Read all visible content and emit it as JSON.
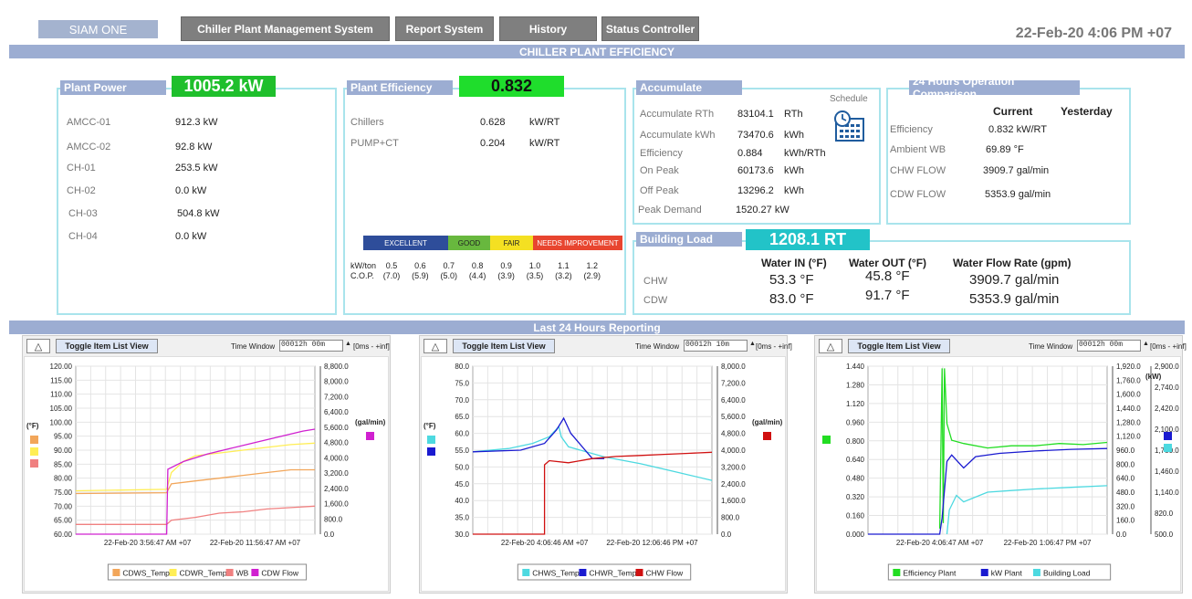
{
  "header": {
    "brand": "SIAM ONE",
    "nav": [
      "Chiller Plant Management System",
      "Report System",
      "History",
      "Status Controller"
    ],
    "datetime": "22-Feb-20 4:06 PM +07"
  },
  "banner_top": "CHILLER PLANT EFFICIENCY",
  "banner_mid": "Last 24 Hours Reporting",
  "plant_power": {
    "title": "Plant Power",
    "total": "1005.2 kW",
    "rows": [
      {
        "label": "AMCC-01",
        "value": "912.3 kW"
      },
      {
        "label": "AMCC-02",
        "value": "92.8 kW"
      },
      {
        "label": "CH-01",
        "value": "253.5 kW"
      },
      {
        "label": "CH-02",
        "value": "0.0 kW"
      },
      {
        "label": "CH-03",
        "value": "504.8 kW"
      },
      {
        "label": "CH-04",
        "value": "0.0 kW"
      }
    ]
  },
  "plant_efficiency": {
    "title": "Plant Efficiency",
    "total": "0.832",
    "rows": [
      {
        "label": "Chillers",
        "value": "0.628",
        "unit": "kW/RT"
      },
      {
        "label": "PUMP+CT",
        "value": "0.204",
        "unit": "kW/RT"
      }
    ],
    "scale_bands": [
      {
        "label": "EXCELLENT",
        "color": "#2e4d9a"
      },
      {
        "label": "GOOD",
        "color": "#68b83e"
      },
      {
        "label": "FAIR",
        "color": "#f4e022"
      },
      {
        "label": "NEEDS IMPROVEMENT",
        "color": "#e8452f"
      }
    ],
    "kwton_label": "kW/ton",
    "cop_label": "C.O.P.",
    "kwton": [
      "0.5",
      "0.6",
      "0.7",
      "0.8",
      "0.9",
      "1.0",
      "1.1",
      "1.2"
    ],
    "cop": [
      "(7.0)",
      "(5.9)",
      "(5.0)",
      "(4.4)",
      "(3.9)",
      "(3.5)",
      "(3.2)",
      "(2.9)"
    ]
  },
  "accumulate": {
    "title": "Accumulate",
    "schedule_label": "Schedule",
    "rows": [
      {
        "label": "Accumulate RTh",
        "value": "83104.1",
        "unit": "RTh"
      },
      {
        "label": "Accumulate kWh",
        "value": "73470.6",
        "unit": "kWh"
      },
      {
        "label": "Efficiency",
        "value": "0.884",
        "unit": "kWh/RTh"
      },
      {
        "label": "On Peak",
        "value": "60173.6",
        "unit": "kWh"
      },
      {
        "label": "Off Peak",
        "value": "13296.2",
        "unit": "kWh"
      },
      {
        "label": "Peak Demand",
        "value": "1520.27 kW",
        "unit": ""
      }
    ]
  },
  "comparison": {
    "title": "24 Hours Operation Comparison",
    "col_current": "Current",
    "col_yesterday": "Yesterday",
    "rows": [
      {
        "label": "Efficiency",
        "value": "0.832   kW/RT"
      },
      {
        "label": "Ambient  WB",
        "value": "69.89 °F"
      },
      {
        "label": "CHW FLOW",
        "value": "3909.7 gal/min"
      },
      {
        "label": "CDW FLOW",
        "value": "5353.9 gal/min"
      }
    ]
  },
  "building_load": {
    "title": "Building Load",
    "total": "1208.1  RT",
    "col_in": "Water IN (°F)",
    "col_out": "Water OUT (°F)",
    "col_flow": "Water Flow Rate (gpm)",
    "rows": [
      {
        "label": "CHW",
        "in": "53.3 °F",
        "out": "45.8 °F",
        "flow": "3909.7 gal/min"
      },
      {
        "label": "CDW",
        "in": "83.0 °F",
        "out": "91.7 °F",
        "flow": "5353.9 gal/min"
      }
    ]
  },
  "chart_controls": {
    "toggle_label": "Toggle Item List View",
    "tri_label": "△",
    "time_window_label": "Time Window",
    "range_label": "[0ms - +inf]"
  },
  "chart_data": [
    {
      "type": "line",
      "time_window": "00012h 00m",
      "x_ticks": [
        "22-Feb-20 3:56:47 AM +07",
        "22-Feb-20 11:56:47 AM +07"
      ],
      "left_unit": "(°F)",
      "right_unit": "(gal/min)",
      "ylim": [
        60,
        120
      ],
      "y2lim": [
        0,
        8800
      ],
      "y_ticks": [
        "120.00",
        "115.00",
        "110.00",
        "105.00",
        "100.00",
        "95.00",
        "90.00",
        "85.00",
        "80.00",
        "75.00",
        "70.00",
        "65.00",
        "60.00"
      ],
      "y2_ticks": [
        "8,800.0",
        "8,000.0",
        "7,200.0",
        "6,400.0",
        "5,600.0",
        "4,800.0",
        "4,000.0",
        "3,200.0",
        "2,400.0",
        "1,600.0",
        "800.0",
        "0.0"
      ],
      "series": [
        {
          "name": "CDWS_Temp",
          "color": "#f2a65a",
          "axis": "left",
          "points": [
            [
              0,
              74.5
            ],
            [
              0.38,
              74.8
            ],
            [
              0.4,
              78
            ],
            [
              0.5,
              79
            ],
            [
              0.6,
              80
            ],
            [
              0.7,
              81
            ],
            [
              0.8,
              82
            ],
            [
              0.9,
              83
            ],
            [
              1,
              83
            ]
          ]
        },
        {
          "name": "CDWR_Temp",
          "color": "#ffee55",
          "axis": "left",
          "points": [
            [
              0,
              75.5
            ],
            [
              0.38,
              76
            ],
            [
              0.4,
              82
            ],
            [
              0.45,
              86
            ],
            [
              0.5,
              88
            ],
            [
              0.6,
              89
            ],
            [
              0.7,
              90
            ],
            [
              0.8,
              91
            ],
            [
              0.9,
              92
            ],
            [
              1,
              92.5
            ]
          ]
        },
        {
          "name": "WB",
          "color": "#f08080",
          "axis": "left",
          "points": [
            [
              0,
              63.5
            ],
            [
              0.38,
              63.5
            ],
            [
              0.4,
              65
            ],
            [
              0.5,
              66
            ],
            [
              0.6,
              67.5
            ],
            [
              0.7,
              68
            ],
            [
              0.8,
              69
            ],
            [
              0.9,
              69.5
            ],
            [
              1,
              70
            ]
          ]
        },
        {
          "name": "CDW Flow",
          "color": "#d020d0",
          "axis": "right",
          "points": [
            [
              0,
              0
            ],
            [
              0.38,
              0
            ],
            [
              0.385,
              3400
            ],
            [
              0.45,
              3800
            ],
            [
              0.55,
              4200
            ],
            [
              0.65,
              4500
            ],
            [
              0.75,
              4800
            ],
            [
              0.85,
              5100
            ],
            [
              0.95,
              5400
            ],
            [
              1,
              5500
            ]
          ]
        }
      ]
    },
    {
      "type": "line",
      "time_window": "00012h 10m",
      "x_ticks": [
        "22-Feb-20 4:06:46 AM +07",
        "22-Feb-20 12:06:46 PM +07"
      ],
      "left_unit": "(°F)",
      "right_unit": "(gal/min)",
      "ylim": [
        30,
        80
      ],
      "y2lim": [
        0,
        8000
      ],
      "y_ticks": [
        "80.0",
        "75.0",
        "70.0",
        "65.0",
        "60.0",
        "55.0",
        "50.0",
        "45.0",
        "40.0",
        "35.0",
        "30.0"
      ],
      "y2_ticks": [
        "8,000.0",
        "7,200.0",
        "6,400.0",
        "5,600.0",
        "4,800.0",
        "4,000.0",
        "3,200.0",
        "2,400.0",
        "1,600.0",
        "800.0",
        "0.0"
      ],
      "series": [
        {
          "name": "CHWS_Temp",
          "color": "#4dd9e0",
          "axis": "left",
          "points": [
            [
              0,
              54.5
            ],
            [
              0.15,
              55.5
            ],
            [
              0.25,
              57
            ],
            [
              0.32,
              59
            ],
            [
              0.36,
              62
            ],
            [
              0.37,
              59
            ],
            [
              0.4,
              56
            ],
            [
              0.55,
              53
            ],
            [
              0.7,
              51
            ],
            [
              0.85,
              48.5
            ],
            [
              1,
              46
            ]
          ]
        },
        {
          "name": "CHWR_Temp",
          "color": "#1a1ad0",
          "axis": "left",
          "points": [
            [
              0,
              54.5
            ],
            [
              0.2,
              55
            ],
            [
              0.3,
              57
            ],
            [
              0.35,
              61
            ],
            [
              0.38,
              64.5
            ],
            [
              0.41,
              60
            ],
            [
              0.47,
              55
            ],
            [
              0.5,
              52.5
            ],
            [
              0.55,
              52.5
            ]
          ]
        },
        {
          "name": "CHW Flow",
          "color": "#d01010",
          "axis": "right",
          "points": [
            [
              0,
              0
            ],
            [
              0.3,
              0
            ],
            [
              0.3,
              3300
            ],
            [
              0.32,
              3500
            ],
            [
              0.4,
              3400
            ],
            [
              0.5,
              3600
            ],
            [
              0.6,
              3700
            ],
            [
              0.7,
              3750
            ],
            [
              0.8,
              3800
            ],
            [
              0.9,
              3850
            ],
            [
              1,
              3900
            ]
          ]
        }
      ]
    },
    {
      "type": "line",
      "time_window": "00012h 00m",
      "x_ticks": [
        "22-Feb-20 4:06:47 AM +07",
        "22-Feb-20 1:06:47 PM +07"
      ],
      "right_unit": "(kW)",
      "ylim": [
        0,
        1.52
      ],
      "y2lim": [
        0,
        2080
      ],
      "y_ticks": [
        "1.440",
        "1.280",
        "1.120",
        "0.960",
        "0.800",
        "0.640",
        "0.480",
        "0.320",
        "0.160",
        "0.000"
      ],
      "y2_ticks": [
        "1,920.0",
        "1,760.0",
        "1,600.0",
        "1,440.0",
        "1,280.0",
        "1,120.0",
        "960.0",
        "800.0",
        "640.0",
        "480.0",
        "320.0",
        "160.0",
        "0.0"
      ],
      "y3_ticks": [
        "2,900.0",
        "2,740.0",
        "2,420.0",
        "2,100.0",
        "1,780.0",
        "1,460.0",
        "1,140.0",
        "820.0",
        "500.0"
      ],
      "series": [
        {
          "name": "Efficiency Plant",
          "color": "#22dd22",
          "axis": "left",
          "points": [
            [
              0.3,
              0.05
            ],
            [
              0.31,
              1.5
            ],
            [
              0.315,
              0.1
            ],
            [
              0.32,
              1.5
            ],
            [
              0.33,
              1.0
            ],
            [
              0.35,
              0.85
            ],
            [
              0.4,
              0.82
            ],
            [
              0.5,
              0.78
            ],
            [
              0.6,
              0.8
            ],
            [
              0.7,
              0.8
            ],
            [
              0.8,
              0.82
            ],
            [
              0.9,
              0.81
            ],
            [
              1,
              0.83
            ]
          ]
        },
        {
          "name": "kW Plant",
          "color": "#1a1ad0",
          "axis": "right",
          "points": [
            [
              0,
              0
            ],
            [
              0.3,
              0
            ],
            [
              0.31,
              200
            ],
            [
              0.33,
              900
            ],
            [
              0.35,
              980
            ],
            [
              0.4,
              820
            ],
            [
              0.45,
              960
            ],
            [
              0.55,
              1000
            ],
            [
              0.7,
              1030
            ],
            [
              0.85,
              1050
            ],
            [
              1,
              1060
            ]
          ]
        },
        {
          "name": "Building Load",
          "color": "#4dd9e0",
          "axis": "right",
          "points": [
            [
              0.33,
              0
            ],
            [
              0.34,
              300
            ],
            [
              0.37,
              480
            ],
            [
              0.4,
              400
            ],
            [
              0.5,
              520
            ],
            [
              0.6,
              540
            ],
            [
              0.7,
              560
            ],
            [
              0.85,
              580
            ],
            [
              1,
              600
            ]
          ]
        }
      ]
    }
  ]
}
